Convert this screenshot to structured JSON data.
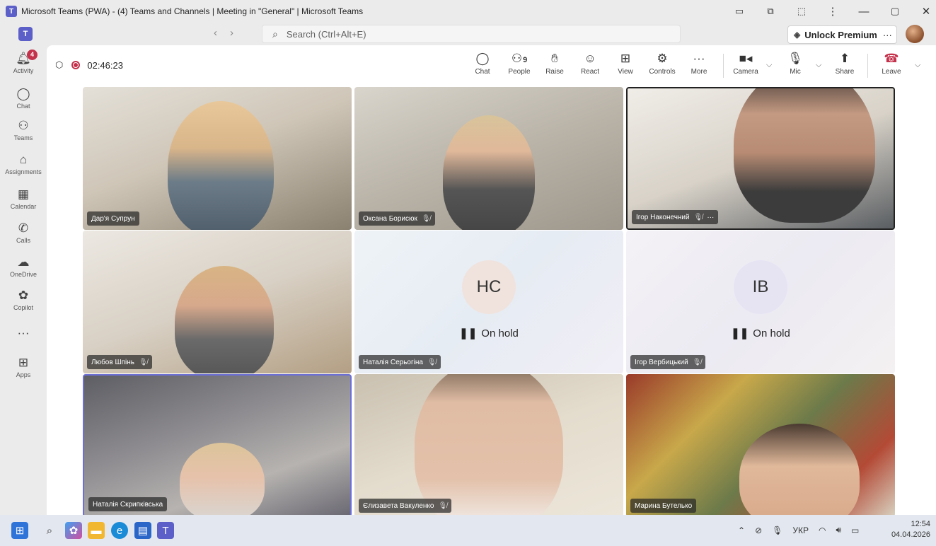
{
  "window": {
    "title": "Microsoft Teams (PWA) - (4) Teams and Channels | Meeting in \"General\" | Microsoft Teams"
  },
  "search": {
    "placeholder": "Search (Ctrl+Alt+E)"
  },
  "premium": {
    "label": "Unlock Premium"
  },
  "rail": [
    {
      "label": "Activity",
      "icon": "bell-icon",
      "badge": "4"
    },
    {
      "label": "Chat",
      "icon": "chat-icon"
    },
    {
      "label": "Teams",
      "icon": "teams-icon"
    },
    {
      "label": "Assignments",
      "icon": "assignments-icon"
    },
    {
      "label": "Calendar",
      "icon": "calendar-icon"
    },
    {
      "label": "Calls",
      "icon": "phone-icon"
    },
    {
      "label": "OneDrive",
      "icon": "cloud-icon"
    },
    {
      "label": "Copilot",
      "icon": "copilot-icon"
    },
    {
      "label": "",
      "icon": "more-icon"
    },
    {
      "label": "Apps",
      "icon": "plus-icon"
    }
  ],
  "meeting": {
    "timer": "02:46:23",
    "toolbar": {
      "chat": "Chat",
      "people": "People",
      "people_count": "9",
      "raise": "Raise",
      "react": "React",
      "view": "View",
      "controls": "Controls",
      "more": "More",
      "camera": "Camera",
      "mic": "Mic",
      "share": "Share",
      "leave": "Leave"
    }
  },
  "participants": [
    {
      "name": "Дар'я Супрун",
      "muted": false,
      "state": "video"
    },
    {
      "name": "Оксана Борисюк",
      "muted": true,
      "state": "video"
    },
    {
      "name": "Ігор Наконечний",
      "muted": true,
      "state": "video",
      "more": "···"
    },
    {
      "name": "Любов Шпінь",
      "muted": true,
      "state": "video"
    },
    {
      "name": "Наталія Серьогіна",
      "muted": true,
      "state": "hold",
      "initials": "НС",
      "hold_text": "On hold"
    },
    {
      "name": "Ігор Вербицький",
      "muted": true,
      "state": "hold",
      "initials": "ІВ",
      "hold_text": "On hold"
    },
    {
      "name": "Наталія Скрипківська",
      "muted": false,
      "state": "video"
    },
    {
      "name": "Єлизавета Вакуленко",
      "muted": true,
      "state": "video"
    },
    {
      "name": "Марина Бутелько",
      "muted": false,
      "state": "video"
    }
  ],
  "tray": {
    "lang": "УКР",
    "time": "12:54",
    "date": "04.04.2026"
  },
  "colors": {
    "accent": "#5b5fc7",
    "leave": "#c4314b",
    "badge": "#c4314b"
  }
}
